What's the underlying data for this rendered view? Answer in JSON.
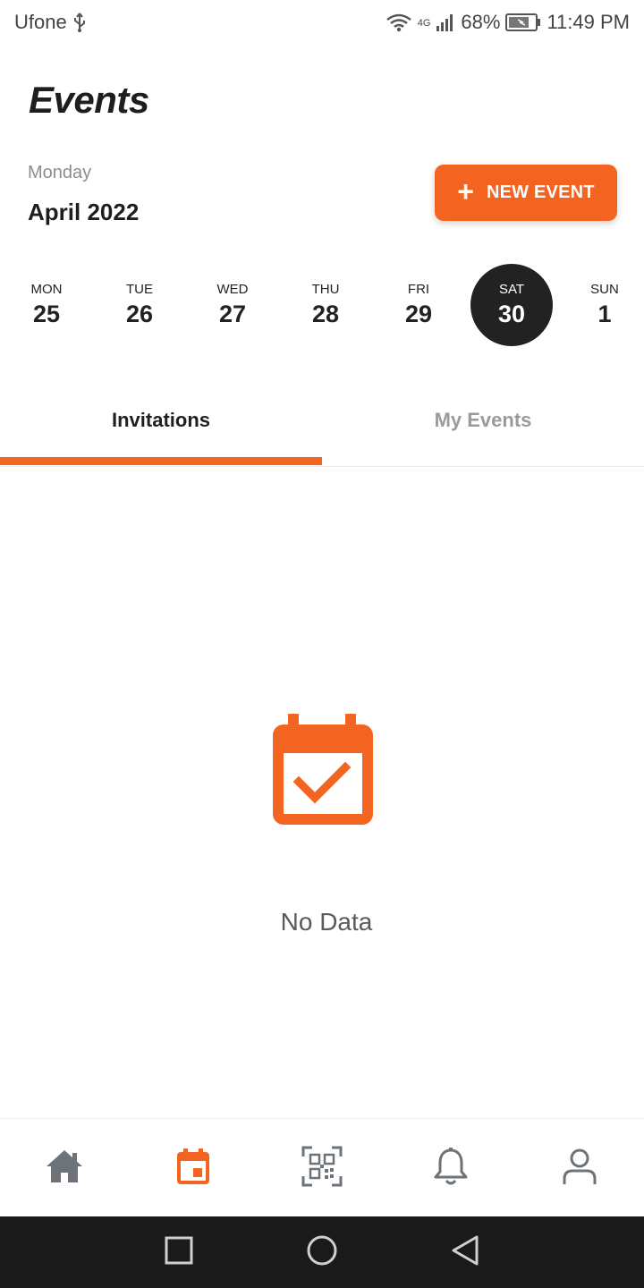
{
  "status_bar": {
    "carrier": "Ufone",
    "network": "4G",
    "battery": "68%",
    "time": "11:49 PM"
  },
  "header": {
    "title": "Events",
    "day_name": "Monday",
    "month_year": "April 2022",
    "new_event_button": {
      "icon": "plus-icon",
      "label": "NEW EVENT"
    }
  },
  "week": [
    {
      "dow": "MON",
      "num": "25",
      "selected": false
    },
    {
      "dow": "TUE",
      "num": "26",
      "selected": false
    },
    {
      "dow": "WED",
      "num": "27",
      "selected": false
    },
    {
      "dow": "THU",
      "num": "28",
      "selected": false
    },
    {
      "dow": "FRI",
      "num": "29",
      "selected": false
    },
    {
      "dow": "SAT",
      "num": "30",
      "selected": true
    },
    {
      "dow": "SUN",
      "num": "1",
      "selected": false
    }
  ],
  "tabs": [
    {
      "label": "Invitations",
      "active": true
    },
    {
      "label": "My Events",
      "active": false
    }
  ],
  "empty_state": {
    "icon": "calendar-check-icon",
    "text": "No Data"
  },
  "bottom_nav": [
    {
      "name": "home",
      "icon": "home-icon",
      "active": false
    },
    {
      "name": "events",
      "icon": "calendar-icon",
      "active": true
    },
    {
      "name": "scan",
      "icon": "qr-scan-icon",
      "active": false
    },
    {
      "name": "notifications",
      "icon": "bell-icon",
      "active": false
    },
    {
      "name": "profile",
      "icon": "user-icon",
      "active": false
    }
  ],
  "colors": {
    "accent": "#f36421",
    "selected_day_bg": "#222222",
    "nav_inactive": "#6e7379",
    "system_nav_bg": "#1a1a1a"
  }
}
